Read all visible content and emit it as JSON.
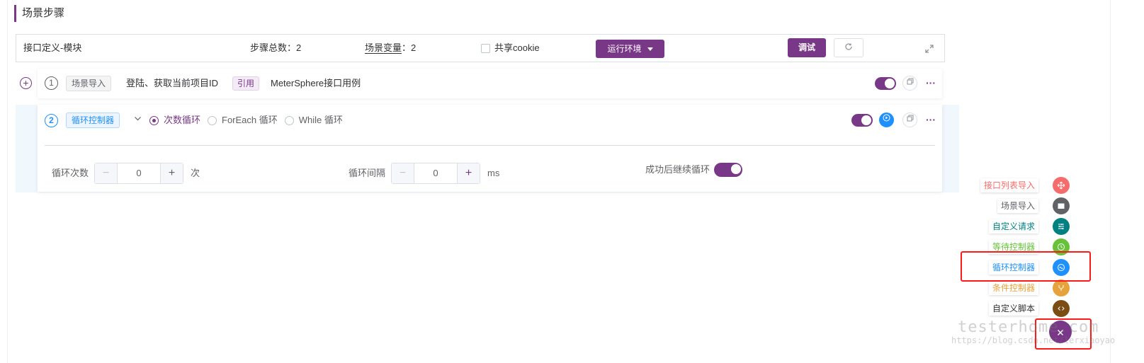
{
  "section": {
    "title": "场景步骤"
  },
  "topbar": {
    "module": "接口定义-模块",
    "step_total_label": "步骤总数：",
    "step_total_value": "2",
    "scene_var_label": "场景变量",
    "scene_var_colon": "：",
    "scene_var_value": "2",
    "share_cookie_label": "共享cookie",
    "share_cookie_checked": false,
    "env_button": "运行环境",
    "debug_button": "调试"
  },
  "steps": [
    {
      "index": "1",
      "tag": "场景导入",
      "name": "登陆、获取当前项目ID",
      "ref_tag": "引用",
      "ref_name": "MeterSphere接口用例",
      "enabled": true
    },
    {
      "index": "2",
      "tag": "循环控制器",
      "loop_types": [
        "次数循环",
        "ForEach 循环",
        "While 循环"
      ],
      "selected_loop_type": "次数循环",
      "enabled": true,
      "loop_count_label": "循环次数",
      "loop_count_value": "0",
      "loop_count_unit": "次",
      "loop_interval_label": "循环间隔",
      "loop_interval_value": "0",
      "loop_interval_unit": "ms",
      "continue_label": "成功后继续循环",
      "continue_enabled": true
    }
  ],
  "float_menu": {
    "items": [
      {
        "label": "接口列表导入",
        "color": "#f56c6c",
        "icon": "move-icon"
      },
      {
        "label": "场景导入",
        "color": "#606266",
        "icon": "clapperboard-icon"
      },
      {
        "label": "自定义请求",
        "color": "#008080",
        "icon": "sliders-icon"
      },
      {
        "label": "等待控制器",
        "color": "#67c23a",
        "icon": "clock-icon"
      },
      {
        "label": "循环控制器",
        "color": "#1e90ff",
        "icon": "loop-icon"
      },
      {
        "label": "条件控制器",
        "color": "#e6a23c",
        "icon": "branch-icon"
      },
      {
        "label": "自定义脚本",
        "color": "#7b4d12",
        "icon": "code-icon"
      }
    ],
    "main_icon": "close-icon",
    "main_color": "#783887"
  },
  "watermark": {
    "text": "testerhome.com",
    "url": "https://blog.csdn.net/lerxiaoyao"
  },
  "colors": {
    "primary": "#783887",
    "highlight": "#ff1a1a"
  }
}
